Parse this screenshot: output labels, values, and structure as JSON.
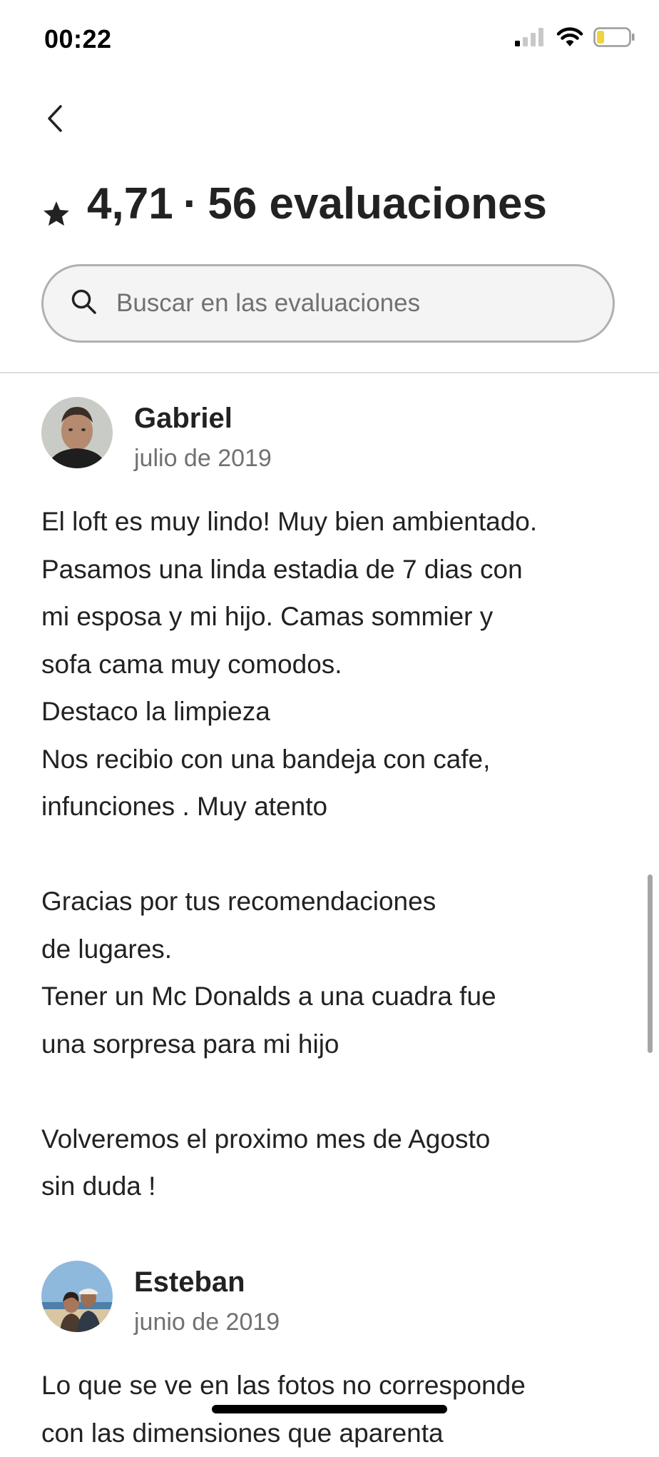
{
  "status_bar": {
    "time": "00:22",
    "icons": [
      "cellular-signal-icon",
      "wifi-icon",
      "battery-icon"
    ],
    "battery_color": "#f2d33c"
  },
  "nav": {
    "back_icon": "chevron-left-icon"
  },
  "header": {
    "star_icon": "star-icon",
    "rating": "4,71",
    "separator": "·",
    "reviews_count": "56 evaluaciones"
  },
  "search": {
    "icon": "search-icon",
    "placeholder": "Buscar en las evaluaciones",
    "value": ""
  },
  "reviews": [
    {
      "name": "Gabriel",
      "date": "julio de 2019",
      "text": "El loft es muy lindo! Muy bien ambientado.\nPasamos una linda estadia de 7 dias con\nmi esposa y mi hijo. Camas sommier y\nsofa cama muy comodos.\nDestaco la limpieza\nNos recibio con una bandeja con cafe,\ninfunciones . Muy atento\n\nGracias por tus recomendaciones\nde lugares.\nTener un Mc Donalds a una cuadra  fue\nuna sorpresa para mi hijo\n\nVolveremos el proximo mes de Agosto\nsin duda !"
    },
    {
      "name": "Esteban",
      "date": "junio de 2019",
      "text": "Lo que se ve en las fotos no corresponde\ncon las dimensiones que aparenta"
    }
  ],
  "colors": {
    "text_primary": "#222222",
    "text_secondary": "#717171",
    "border": "#b0b0b0",
    "search_bg": "#f4f4f4"
  }
}
